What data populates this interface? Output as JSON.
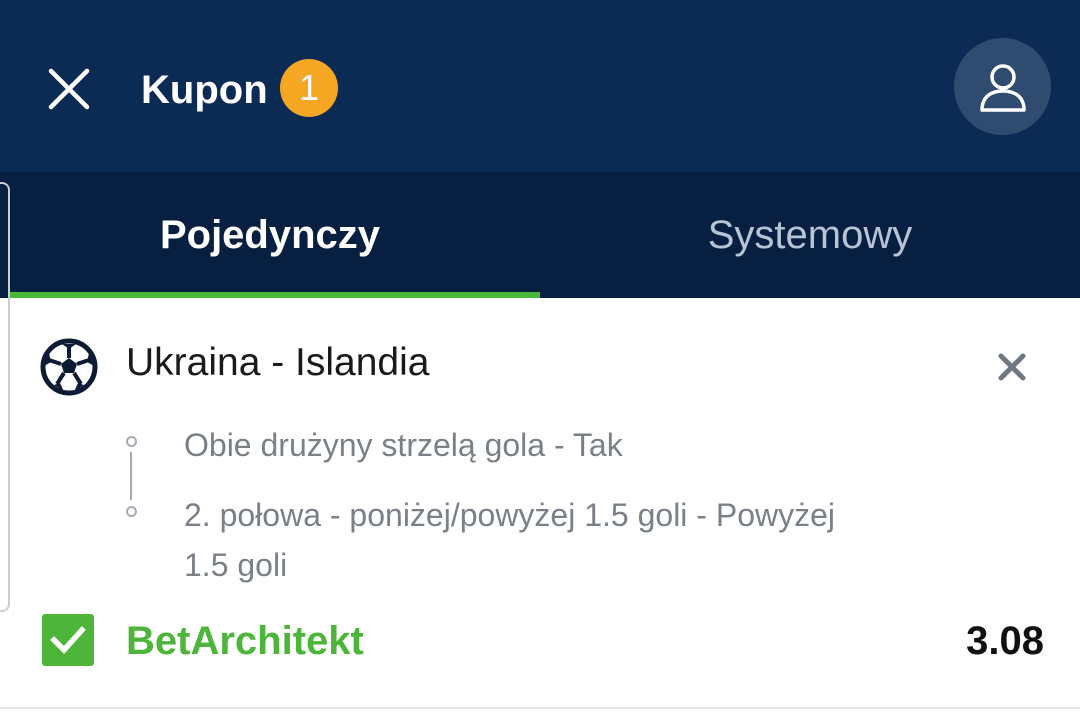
{
  "header": {
    "title": "Kupon",
    "badge_count": "1",
    "close_icon": "close-icon",
    "profile_icon": "user-icon",
    "colors": {
      "background": "#0b2a54",
      "badge": "#f5a623"
    }
  },
  "tabs": [
    {
      "label": "Pojedynczy",
      "active": true
    },
    {
      "label": "Systemowy",
      "active": false
    }
  ],
  "tab_colors": {
    "background": "#071f40",
    "active_indicator": "#49b83a"
  },
  "event": {
    "sport_icon": "soccer-ball-icon",
    "title": "Ukraina - Islandia",
    "remove_icon": "close-icon",
    "selections": [
      "Obie drużyny strzelą gola - Tak",
      "2. połowa - poniżej/powyżej 1.5 goli - Powyżej 1.5 goli"
    ]
  },
  "bet": {
    "checked": true,
    "name": "BetArchitekt",
    "odds": "3.08",
    "color": "#4cb53a"
  }
}
